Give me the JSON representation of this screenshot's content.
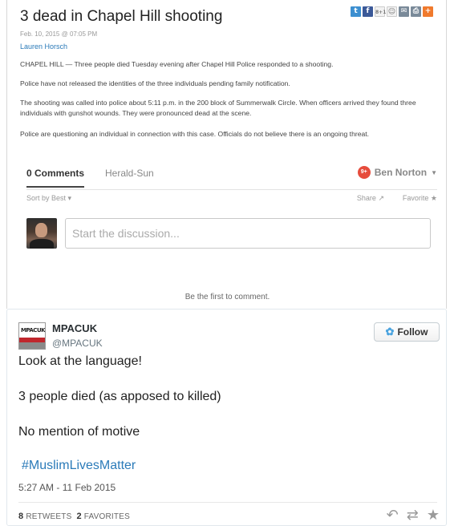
{
  "article": {
    "title": "3 dead in Chapel Hill shooting",
    "date": "Feb. 10, 2015 @ 07:05 PM",
    "author": "Lauren Horsch",
    "paragraphs": [
      "CHAPEL HILL — Three people died Tuesday evening after Chapel Hill Police responded to a shooting.",
      "Police have not released the identities of the three individuals pending family notification.",
      "The shooting was called into police about 5:11 p.m. in the 200 block of Summerwalk Circle. When officers arrived they found three individuals with gunshot wounds. They were pronounced dead at the scene.",
      "Police are questioning an individual in connection with this case. Officials do not believe there is an ongoing threat."
    ],
    "share_icons": [
      {
        "name": "twitter-icon",
        "glyph": "t",
        "color": "#3c8fd0"
      },
      {
        "name": "facebook-icon",
        "glyph": "f",
        "color": "#3b5998"
      },
      {
        "name": "googleplus-icon",
        "glyph": "8+1",
        "color": "#f2f2f2"
      },
      {
        "name": "reddit-icon",
        "glyph": "☺",
        "color": "#f2f2f2"
      },
      {
        "name": "email-icon",
        "glyph": "✉",
        "color": "#7a8a99"
      },
      {
        "name": "print-icon",
        "glyph": "⎙",
        "color": "#7a8a99"
      },
      {
        "name": "more-icon",
        "glyph": "+",
        "color": "#f07a2d"
      }
    ]
  },
  "comments": {
    "tab_comments": "0 Comments",
    "tab_site": "Herald-Sun",
    "notification_count": "9+",
    "user_name": "Ben Norton",
    "sort_label": "Sort by Best",
    "share_label": "Share",
    "favorite_label": "Favorite",
    "input_placeholder": "Start the discussion...",
    "empty_message": "Be the first to comment."
  },
  "tweet": {
    "name": "MPACUK",
    "handle": "@MPACUK",
    "logo_text": "MPACUK",
    "follow_label": "Follow",
    "lines": [
      "Look at the language!",
      "3 people died (as apposed to killed)",
      "No mention of motive"
    ],
    "hashtag": "#MuslimLivesMatter",
    "timestamp": "5:27 AM - 11 Feb 2015",
    "retweets_count": "8",
    "retweets_label": "RETWEETS",
    "favorites_count": "2",
    "favorites_label": "FAVORITES"
  }
}
